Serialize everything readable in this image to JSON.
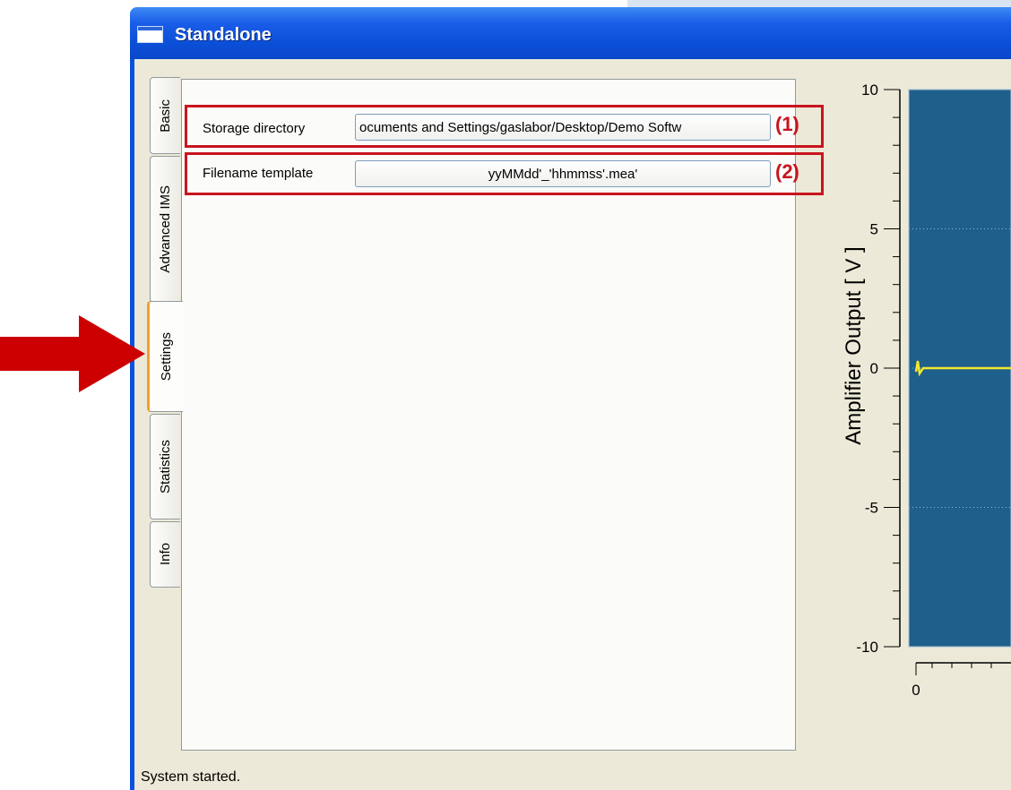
{
  "window": {
    "title": "Standalone"
  },
  "tabs": [
    {
      "label": "Basic"
    },
    {
      "label": "Advanced IMS"
    },
    {
      "label": "Settings",
      "active": true
    },
    {
      "label": "Statistics"
    },
    {
      "label": "Info"
    }
  ],
  "settings": {
    "storage_label": "Storage directory",
    "storage_value": "ocuments and Settings/gaslabor/Desktop/Demo Softw",
    "filename_label": "Filename template",
    "filename_value": "yyMMdd'_'hhmmss'.mea'"
  },
  "annotations": {
    "marker1": "(1)",
    "marker2": "(2)"
  },
  "chart_data": {
    "type": "line",
    "ylabel": "Amplifier Output [ V ]",
    "ylim": [
      -10,
      10
    ],
    "y_ticks": [
      "10",
      "5",
      "0",
      "-5",
      "-10"
    ],
    "x_ticks": [
      "0"
    ],
    "series": [
      {
        "values": [
          0.5,
          0.0,
          0.0,
          0.0,
          0.0,
          0.0,
          0.0
        ]
      }
    ],
    "colors": {
      "plot_bg": "#1f5f8b",
      "line": "#f2e830"
    },
    "grid": true
  },
  "status": {
    "text": "System started."
  },
  "colors": {
    "highlight": "#c8141e",
    "arrow": "#cc0000"
  }
}
